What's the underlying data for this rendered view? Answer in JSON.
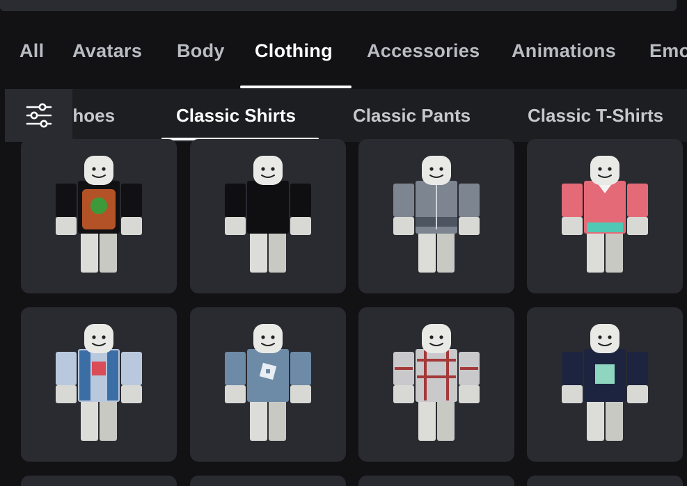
{
  "category_tabs": [
    {
      "label": "All"
    },
    {
      "label": "Avatars"
    },
    {
      "label": "Body"
    },
    {
      "label": "Clothing",
      "active": true
    },
    {
      "label": "Accessories"
    },
    {
      "label": "Animations"
    },
    {
      "label": "Emo"
    }
  ],
  "subcategory_tabs": [
    {
      "label": "Shoes"
    },
    {
      "label": "Classic Shirts",
      "active": true
    },
    {
      "label": "Classic Pants"
    },
    {
      "label": "Classic T-Shirts"
    }
  ],
  "filter": {
    "icon": "sliders-icon"
  },
  "items": [
    {
      "shirt": "black-graphic",
      "colors": {
        "main": "#111113",
        "accent": "#c75a2a"
      }
    },
    {
      "shirt": "plain-black",
      "colors": {
        "main": "#0f0f11",
        "accent": "#1e1e22"
      }
    },
    {
      "shirt": "gray-zip-hoodie",
      "colors": {
        "main": "#7d8590",
        "accent": "#4d5560"
      }
    },
    {
      "shirt": "pink-teal",
      "colors": {
        "main": "#e46a77",
        "accent": "#4fc8b4"
      }
    },
    {
      "shirt": "light-blue-vest",
      "colors": {
        "main": "#b9c8dc",
        "accent": "#3b6ea5"
      }
    },
    {
      "shirt": "blue-roblox-logo",
      "colors": {
        "main": "#6d8aa6",
        "accent": "#e8eef4"
      }
    },
    {
      "shirt": "red-plaid",
      "colors": {
        "main": "#c9c9cc",
        "accent": "#a12a2a"
      }
    },
    {
      "shirt": "navy-graphic",
      "colors": {
        "main": "#1c2440",
        "accent": "#8fd6c0"
      }
    }
  ],
  "colors": {
    "background": "#121215",
    "card": "#2a2b31",
    "active_text": "#ffffff",
    "inactive_text": "#b9bcc3"
  }
}
